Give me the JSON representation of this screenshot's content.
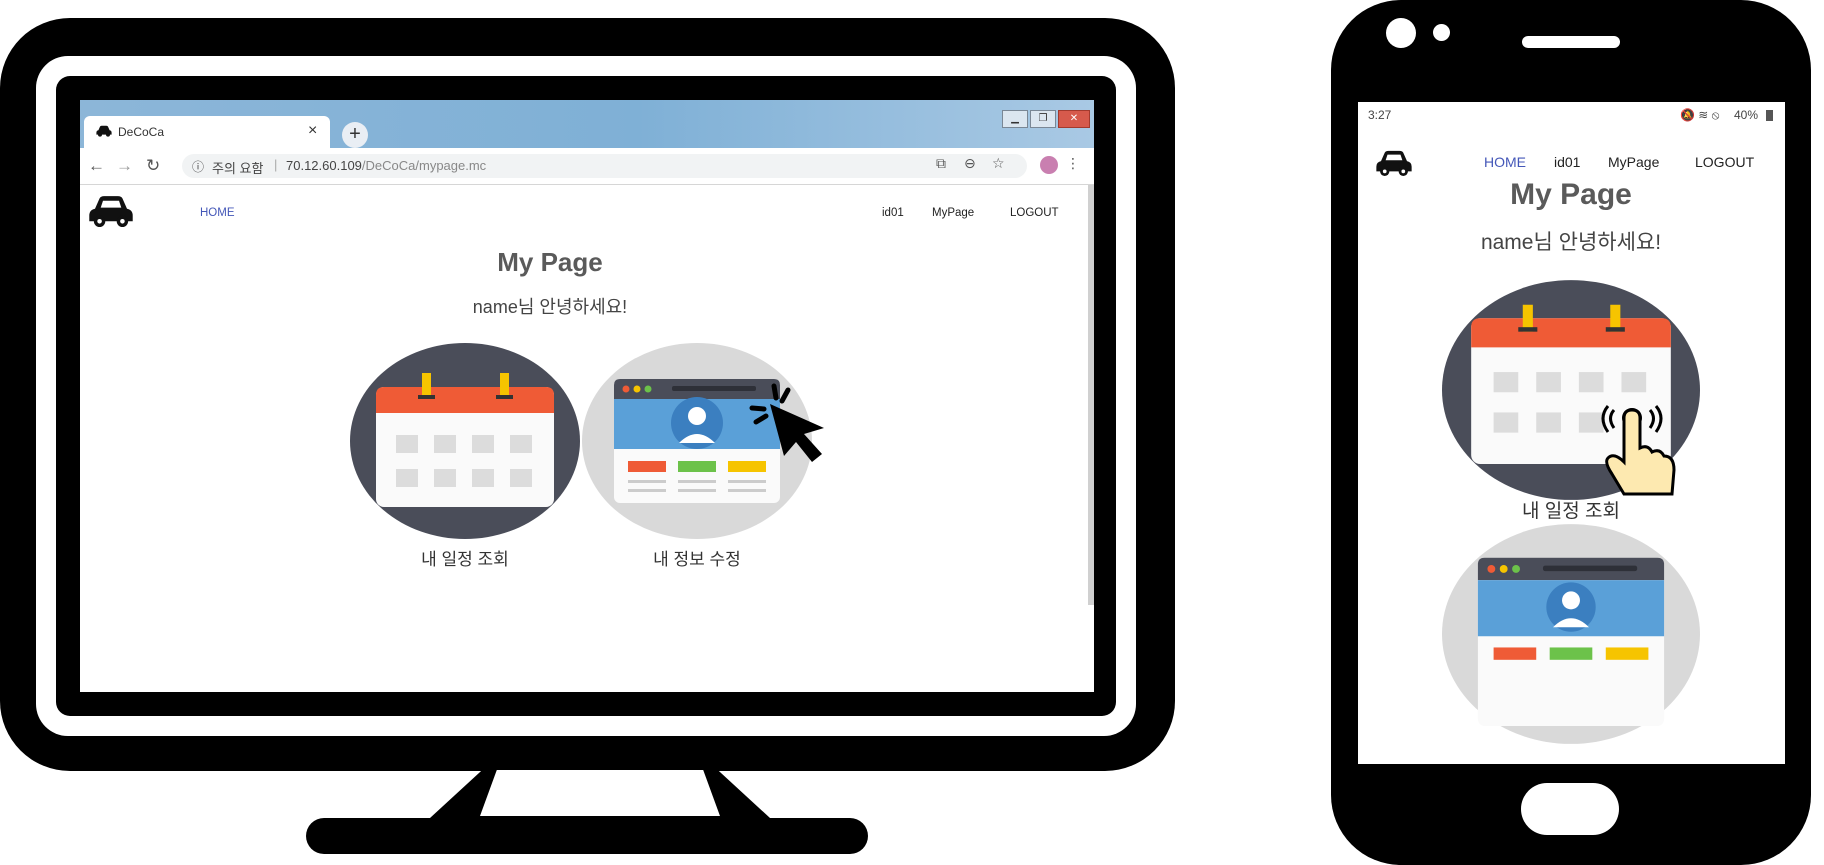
{
  "browser": {
    "tab_title": "DeCoCa",
    "tab_close": "×",
    "new_tab": "+",
    "window_buttons": [
      "▁",
      "❐",
      "✕"
    ],
    "security_label": "주의 요함",
    "url_host": "70.12.60.109",
    "url_path": "/DeCoCa/mypage.mc"
  },
  "site": {
    "nav": {
      "home": "HOME",
      "user": "id01",
      "mypage": "MyPage",
      "logout": "LOGOUT"
    },
    "title": "My Page",
    "greeting": "name님 안녕하세요!",
    "cards": [
      {
        "label": "내 일정 조회"
      },
      {
        "label": "내 정보 수정"
      }
    ]
  },
  "phone": {
    "time": "3:27",
    "battery": "40%"
  },
  "colors": {
    "calendar_header": "#ef5b36",
    "calendar_body": "#fafafa",
    "calendar_tab": "#f6c400",
    "circle_dark": "#4a4d59",
    "circle_light": "#d9d9d9",
    "profile_blue": "#5aa0d8",
    "nav_active": "#4457b8"
  },
  "icons": [
    "car-icon",
    "calendar-icon",
    "profile-card-icon",
    "cursor-click-icon",
    "tap-hand-icon"
  ]
}
